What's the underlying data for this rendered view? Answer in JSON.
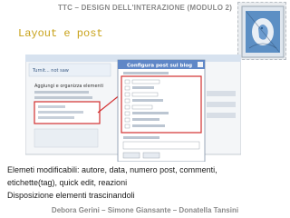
{
  "slide": {
    "header": "TTC – DESIGN DELL'INTERAZIONE (MODULO 2)",
    "title": "Layout e post",
    "caption_lines": [
      "Elemeti modificabili: autore, data, numero post, commenti,",
      "etichette(tag), quick edit, reazioni",
      "Disposizione elementi trascinandoli"
    ],
    "footer": "Debora Gerini – Simone Giansante – Donatella Tansini"
  },
  "screenshot": {
    "back_window_label": "Turnit... not saw",
    "back_heading": "Aggiungi e organizza elementi",
    "dialog_title": "Configura post sul blog"
  },
  "colors": {
    "title": "#c8a21a",
    "header": "#8a8a8a",
    "dialog_header": "#5f87c7",
    "highlight": "#d32f2f",
    "stamp_ink": "#3a70a8"
  }
}
